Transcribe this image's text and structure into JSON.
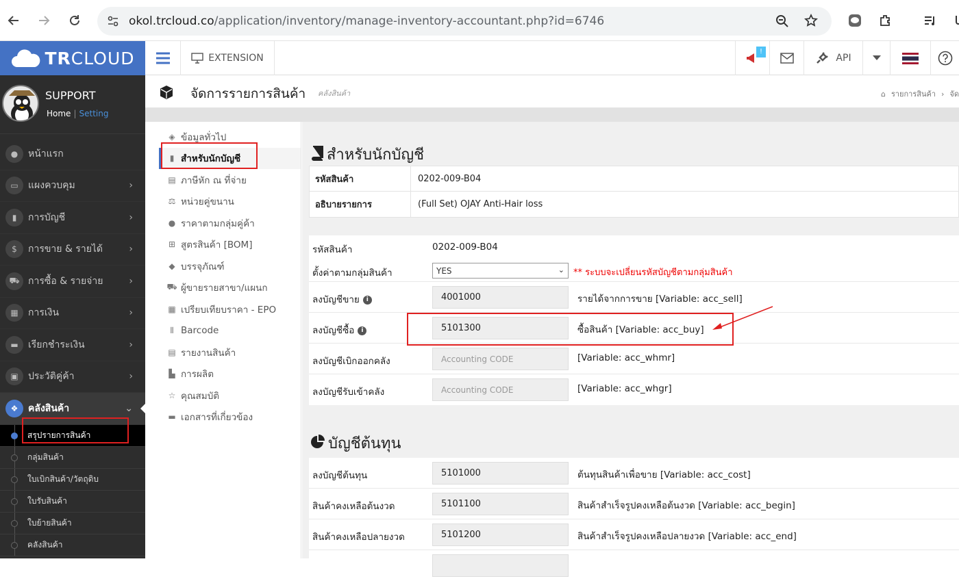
{
  "browser": {
    "url_host": "okol.trcloud.co",
    "url_path": "/application/inventory/manage-inventory-accountant.php?id=6746"
  },
  "sidebar": {
    "logo_bold": "TR",
    "logo_rest": "CLOUD",
    "user_name": "SUPPORT",
    "home_link": "Home",
    "setting_link": "Setting",
    "items": [
      {
        "label": "หน้าแรก",
        "icon": "home-icon"
      },
      {
        "label": "แผงควบคุม",
        "icon": "monitor-icon"
      },
      {
        "label": "การบัญชี",
        "icon": "book-icon"
      },
      {
        "label": "การขาย & รายได้",
        "icon": "dollar-icon"
      },
      {
        "label": "การซื้อ & รายจ่าย",
        "icon": "cart-icon"
      },
      {
        "label": "การเงิน",
        "icon": "calendar-icon"
      },
      {
        "label": "เรียกชำระเงิน",
        "icon": "card-icon"
      },
      {
        "label": "ประวัติคู่ค้า",
        "icon": "contact-icon"
      },
      {
        "label": "คลังสินค้า",
        "icon": "boxes-icon"
      }
    ],
    "sub_items": [
      "สรุปรายการสินค้า",
      "กลุ่มสินค้า",
      "ใบเบิกสินค้า/วัตถุดิบ",
      "ใบรับสินค้า",
      "ใบย้ายสินค้า",
      "คลังสินค้า"
    ]
  },
  "topbar": {
    "extension_label": "EXTENSION",
    "api_label": "API",
    "notify_badge": "!"
  },
  "header": {
    "title": "จัดการรายการสินค้า",
    "subtitle": "คลังสินค้า",
    "breadcrumb_1": "รายการสินค้า",
    "breadcrumb_2": "จัด"
  },
  "submenu": [
    {
      "label": "ข้อมูลทั่วไป",
      "icon": "cube-icon"
    },
    {
      "label": "สำหรับนักบัญชี",
      "icon": "book-icon"
    },
    {
      "label": "ภาษีหัก ณ ที่จ่าย",
      "icon": "document-icon"
    },
    {
      "label": "หน่วยคู่ขนาน",
      "icon": "scale-icon"
    },
    {
      "label": "ราคาตามกลุ่มคู่ค้า",
      "icon": "users-icon"
    },
    {
      "label": "สูตรสินค้า [BOM]",
      "icon": "sitemap-icon"
    },
    {
      "label": "บรรจุภัณฑ์",
      "icon": "dropbox-icon"
    },
    {
      "label": "ผู้ขายรายสาขา/แผนก",
      "icon": "cart-icon"
    },
    {
      "label": "เปรียบเทียบราคา - EPO",
      "icon": "table-icon"
    },
    {
      "label": "Barcode",
      "icon": "barcode-icon"
    },
    {
      "label": "รายงานสินค้า",
      "icon": "file-icon"
    },
    {
      "label": "การผลิต",
      "icon": "industry-icon"
    },
    {
      "label": "คุณสมบัติ",
      "icon": "star-icon"
    },
    {
      "label": "เอกสารที่เกี่ยวข้อง",
      "icon": "folder-icon"
    }
  ],
  "main": {
    "section1_title": "สำหรับนักบัญชี",
    "info": [
      {
        "key": "รหัสสินค้า",
        "value": "0202-009-B04"
      },
      {
        "key": "อธิบายรายการ",
        "value": "(Full Set) OJAY Anti-Hair loss"
      }
    ],
    "code_label": "รหัสสินค้า",
    "code_value": "0202-009-B04",
    "group_label": "ตั้งค่าตามกลุ่มสินค้า",
    "group_value": "YES",
    "group_note": "** ระบบจะเปลี่ยนรหัสบัญชีตามกลุ่มสินค้า",
    "fields": [
      {
        "label": "ลงบัญชีขาย",
        "value": "4001000",
        "desc": "รายได้จากการขาย [Variable: acc_sell]",
        "info": true
      },
      {
        "label": "ลงบัญชีซื้อ",
        "value": "5101300",
        "desc": "ซื้อสินค้า [Variable: acc_buy]",
        "info": true
      },
      {
        "label": "ลงบัญชีเบิกออกคลัง",
        "placeholder": "Accounting CODE",
        "desc": "[Variable: acc_whmr]"
      },
      {
        "label": "ลงบัญชีรับเข้าคลัง",
        "placeholder": "Accounting CODE",
        "desc": "[Variable: acc_whgr]"
      }
    ],
    "section2_title": "บัญชีต้นทุน",
    "cost_fields": [
      {
        "label": "ลงบัญชีต้นทุน",
        "value": "5101000",
        "desc": "ต้นทุนสินค้าเพื่อขาย [Variable: acc_cost]"
      },
      {
        "label": "สินค้าคงเหลือต้นงวด",
        "value": "5101100",
        "desc": "สินค้าสำเร็จรูปคงเหลือต้นงวด [Variable: acc_begin]"
      },
      {
        "label": "สินค้าคงเหลือปลายงวด",
        "value": "5101200",
        "desc": "สินค้าสำเร็จรูปคงเหลือปลายงวด [Variable: acc_end]"
      }
    ]
  },
  "colors": {
    "brand": "#4472c4",
    "sidebar": "#2d2d2d",
    "highlight": "#e02020"
  }
}
